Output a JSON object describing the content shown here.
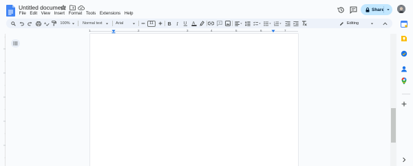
{
  "app": {
    "title": "Untitled document",
    "menu": [
      "File",
      "Edit",
      "View",
      "Insert",
      "Format",
      "Tools",
      "Extensions",
      "Help"
    ],
    "share_label": "Share"
  },
  "toolbar": {
    "zoom": "100%",
    "style": "Normal text",
    "font": "Arial",
    "font_size": "11",
    "mode": "Editing"
  },
  "ruler": {
    "numbers": [
      "1",
      "1",
      "2",
      "3",
      "4",
      "5",
      "6",
      "7"
    ]
  },
  "colors": {
    "accent": "#c2e7ff",
    "page_bg": "#ffffff",
    "chrome_bg": "#f9fbfd",
    "toolbar_bg": "#edf2fa",
    "ruler_marker": "#1a73e8"
  },
  "icons": {
    "title": [
      "star-icon",
      "move-to-folder-icon",
      "cloud-saved-icon"
    ],
    "header_right": [
      "version-history-icon",
      "comments-icon",
      "lock-icon",
      "avatar"
    ],
    "side_panel": [
      "keep-icon",
      "tasks-icon",
      "contacts-icon",
      "maps-icon",
      "add-icon"
    ]
  }
}
